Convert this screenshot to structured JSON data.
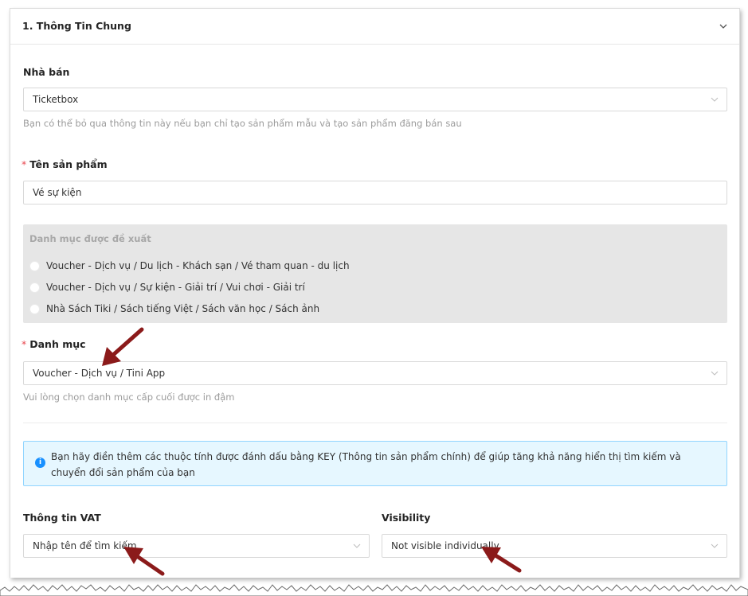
{
  "section": {
    "title": "1. Thông Tin Chung"
  },
  "seller": {
    "label": "Nhà bán",
    "value": "Ticketbox",
    "help": "Bạn có thể bỏ qua thông tin này nếu bạn chỉ tạo sản phẩm mẫu và tạo sản phẩm đăng bán sau"
  },
  "product_name": {
    "required_mark": "*",
    "label": "Tên sản phẩm",
    "value": "Vé sự kiện"
  },
  "suggested_categories": {
    "title": "Danh mục được đề xuất",
    "options": [
      "Voucher - Dịch vụ / Du lịch - Khách sạn / Vé tham quan - du lịch",
      "Voucher - Dịch vụ / Sự kiện - Giải trí / Vui chơi - Giải trí",
      "Nhà Sách Tiki / Sách tiếng Việt / Sách văn học / Sách ảnh"
    ]
  },
  "category": {
    "required_mark": "*",
    "label": "Danh mục",
    "value": "Voucher - Dịch vụ / Tini App",
    "help": "Vui lòng chọn danh mục cấp cuối được in đậm"
  },
  "info_notice": {
    "icon": "info-icon",
    "text": "Bạn hãy điền thêm các thuộc tính được đánh dấu bằng KEY (Thông tin sản phẩm chính) để giúp tăng khả năng hiển thị tìm kiếm và chuyển đổi sản phẩm của bạn"
  },
  "vat": {
    "label": "Thông tin VAT",
    "placeholder": "Nhập tên để tìm kiếm"
  },
  "visibility": {
    "label": "Visibility",
    "value": "Not visible individually"
  },
  "colors": {
    "annotation_arrow": "#8b1a1a",
    "info_background": "#e6f7ff",
    "info_border": "#91d5ff",
    "info_icon": "#1890ff",
    "required": "#e8474f"
  }
}
